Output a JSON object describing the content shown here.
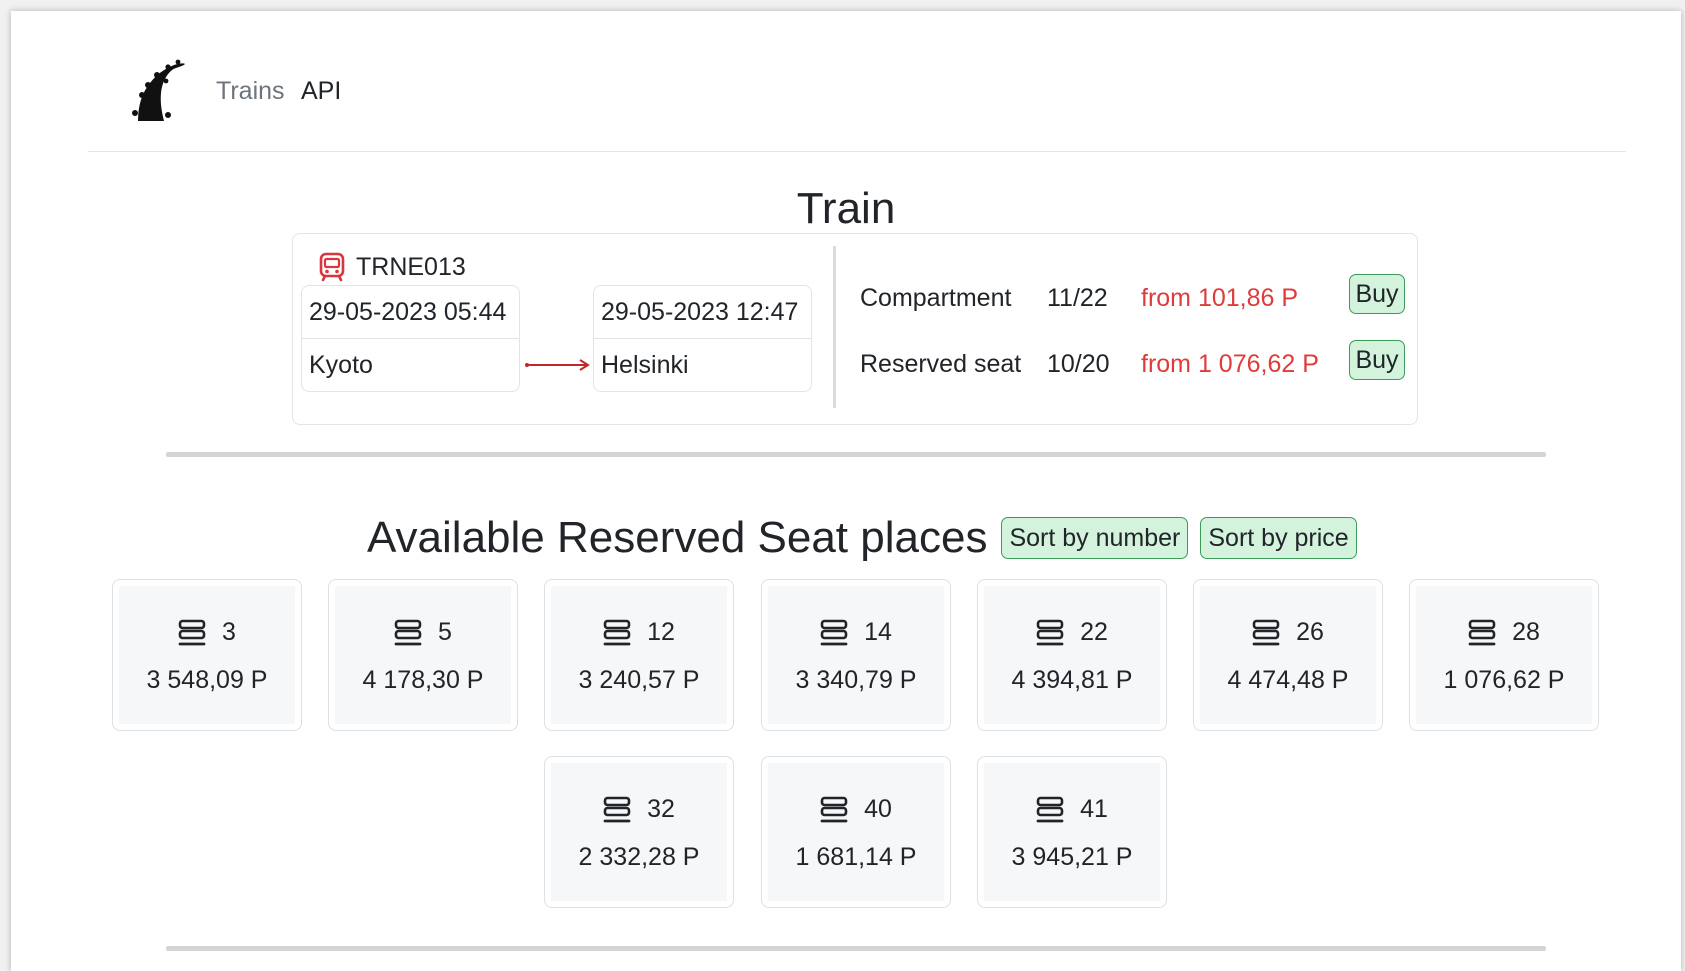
{
  "nav": {
    "logo_icon": "tentacle-logo-icon",
    "links": [
      {
        "label": "Trains",
        "color": "#6c757d"
      },
      {
        "label": "API",
        "color": "#212529"
      }
    ]
  },
  "page_title": "Train",
  "train": {
    "icon": "bus-icon",
    "icon_color": "#d9363e",
    "id": "TRNE013",
    "departure": {
      "datetime": "29-05-2023 05:44",
      "station": "Kyoto"
    },
    "arrival": {
      "datetime": "29-05-2023 12:47",
      "station": "Helsinki"
    },
    "arrow_color": "#c0282e",
    "classes": [
      {
        "name": "Compartment",
        "availability": "11/22",
        "price": "from 101,86 P",
        "button": "Buy"
      },
      {
        "name": "Reserved seat",
        "availability": "10/20",
        "price": "from 1 076,62 P",
        "button": "Buy"
      }
    ]
  },
  "seats_section": {
    "title": "Available Reserved Seat places",
    "sort_buttons": [
      "Sort by number",
      "Sort by price"
    ],
    "seat_icon": "seat-stack-icon",
    "seats": [
      {
        "number": "3",
        "price": "3 548,09 P"
      },
      {
        "number": "5",
        "price": "4 178,30 P"
      },
      {
        "number": "12",
        "price": "3 240,57 P"
      },
      {
        "number": "14",
        "price": "3 340,79 P"
      },
      {
        "number": "22",
        "price": "4 394,81 P"
      },
      {
        "number": "26",
        "price": "4 474,48 P"
      },
      {
        "number": "28",
        "price": "1 076,62 P"
      },
      {
        "number": "32",
        "price": "2 332,28 P"
      },
      {
        "number": "40",
        "price": "1 681,14 P"
      },
      {
        "number": "41",
        "price": "3 945,21 P"
      }
    ]
  },
  "colors": {
    "price_red": "#e03b3b",
    "button_green_bg": "#d3f3dd",
    "button_green_border": "#3d9b5a"
  }
}
